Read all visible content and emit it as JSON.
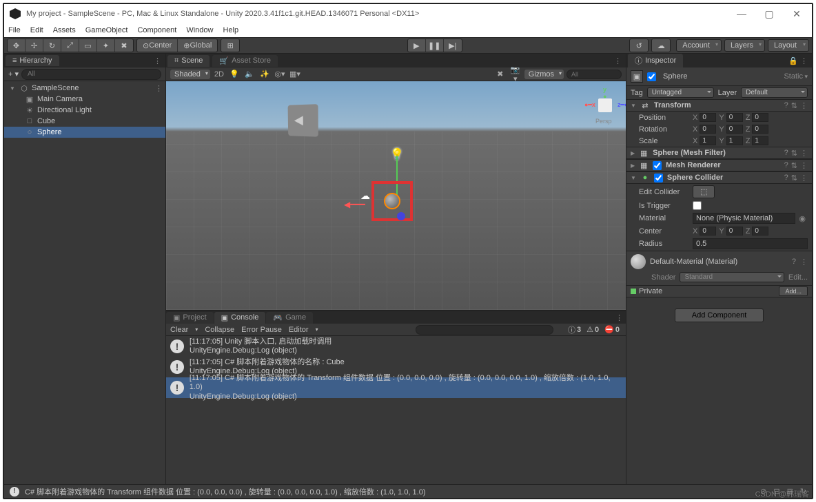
{
  "window": {
    "title": "My project - SampleScene - PC, Mac & Linux Standalone - Unity 2020.3.41f1c1.git.HEAD.1346071 Personal <DX11>"
  },
  "menu": {
    "items": [
      "File",
      "Edit",
      "Assets",
      "GameObject",
      "Component",
      "Window",
      "Help"
    ]
  },
  "toolbar": {
    "pivot": "Center",
    "space": "Global",
    "account": "Account",
    "layers": "Layers",
    "layout": "Layout"
  },
  "hierarchy": {
    "title": "Hierarchy",
    "all": "All",
    "root": "SampleScene",
    "children": [
      "Main Camera",
      "Directional Light",
      "Cube",
      "Sphere"
    ],
    "selected": "Sphere"
  },
  "sceneTabs": {
    "scene": "Scene",
    "assetStore": "Asset Store"
  },
  "sceneTools": {
    "shaded": "Shaded",
    "mode": "2D",
    "gizmos": "Gizmos",
    "all": "All",
    "persp": "Persp"
  },
  "projectTabs": {
    "project": "Project",
    "console": "Console",
    "game": "Game"
  },
  "consoleBar": {
    "clear": "Clear",
    "collapse": "Collapse",
    "errorPause": "Error Pause",
    "editor": "Editor",
    "counts": {
      "info": "3",
      "warn": "0",
      "err": "0"
    }
  },
  "logs": [
    {
      "t": "[11:17:05] Unity 脚本入口, 启动加载时调用",
      "s": "UnityEngine.Debug:Log (object)"
    },
    {
      "t": "[11:17:05] C# 脚本附着游戏物体的名称 : Cube",
      "s": "UnityEngine.Debug:Log (object)"
    },
    {
      "t": "[11:17:05] C# 脚本附着游戏物体的 Transform 组件数据 位置 : (0.0, 0.0, 0.0) , 旋转量 : (0.0, 0.0, 0.0, 1.0) , 缩放倍数 : (1.0, 1.0, 1.0)",
      "s": "UnityEngine.Debug:Log (object)"
    }
  ],
  "inspector": {
    "title": "Inspector",
    "name": "Sphere",
    "static": "Static",
    "tagLabel": "Tag",
    "tag": "Untagged",
    "layerLabel": "Layer",
    "layer": "Default",
    "transform": {
      "title": "Transform",
      "pos": {
        "label": "Position",
        "x": "0",
        "y": "0",
        "z": "0"
      },
      "rot": {
        "label": "Rotation",
        "x": "0",
        "y": "0",
        "z": "0"
      },
      "scale": {
        "label": "Scale",
        "x": "1",
        "y": "1",
        "z": "1"
      }
    },
    "meshFilter": "Sphere (Mesh Filter)",
    "meshRenderer": "Mesh Renderer",
    "collider": {
      "title": "Sphere Collider",
      "edit": "Edit Collider",
      "trigger": "Is Trigger",
      "materialLabel": "Material",
      "material": "None (Physic Material)",
      "center": {
        "label": "Center",
        "x": "0",
        "y": "0",
        "z": "0"
      },
      "radiusLabel": "Radius",
      "radius": "0.5"
    },
    "material": {
      "name": "Default-Material (Material)",
      "shaderLabel": "Shader",
      "shader": "Standard",
      "edit": "Edit..."
    },
    "private": "Private",
    "addbtn": "Add...",
    "addComponent": "Add Component"
  },
  "status": {
    "text": "C# 脚本附着游戏物体的 Transform 组件数据 位置 : (0.0, 0.0, 0.0) , 旋转量 : (0.0, 0.0, 0.0, 1.0) , 缩放倍数 : (1.0, 1.0, 1.0)"
  },
  "watermark": "CSDN @韩瑞客"
}
